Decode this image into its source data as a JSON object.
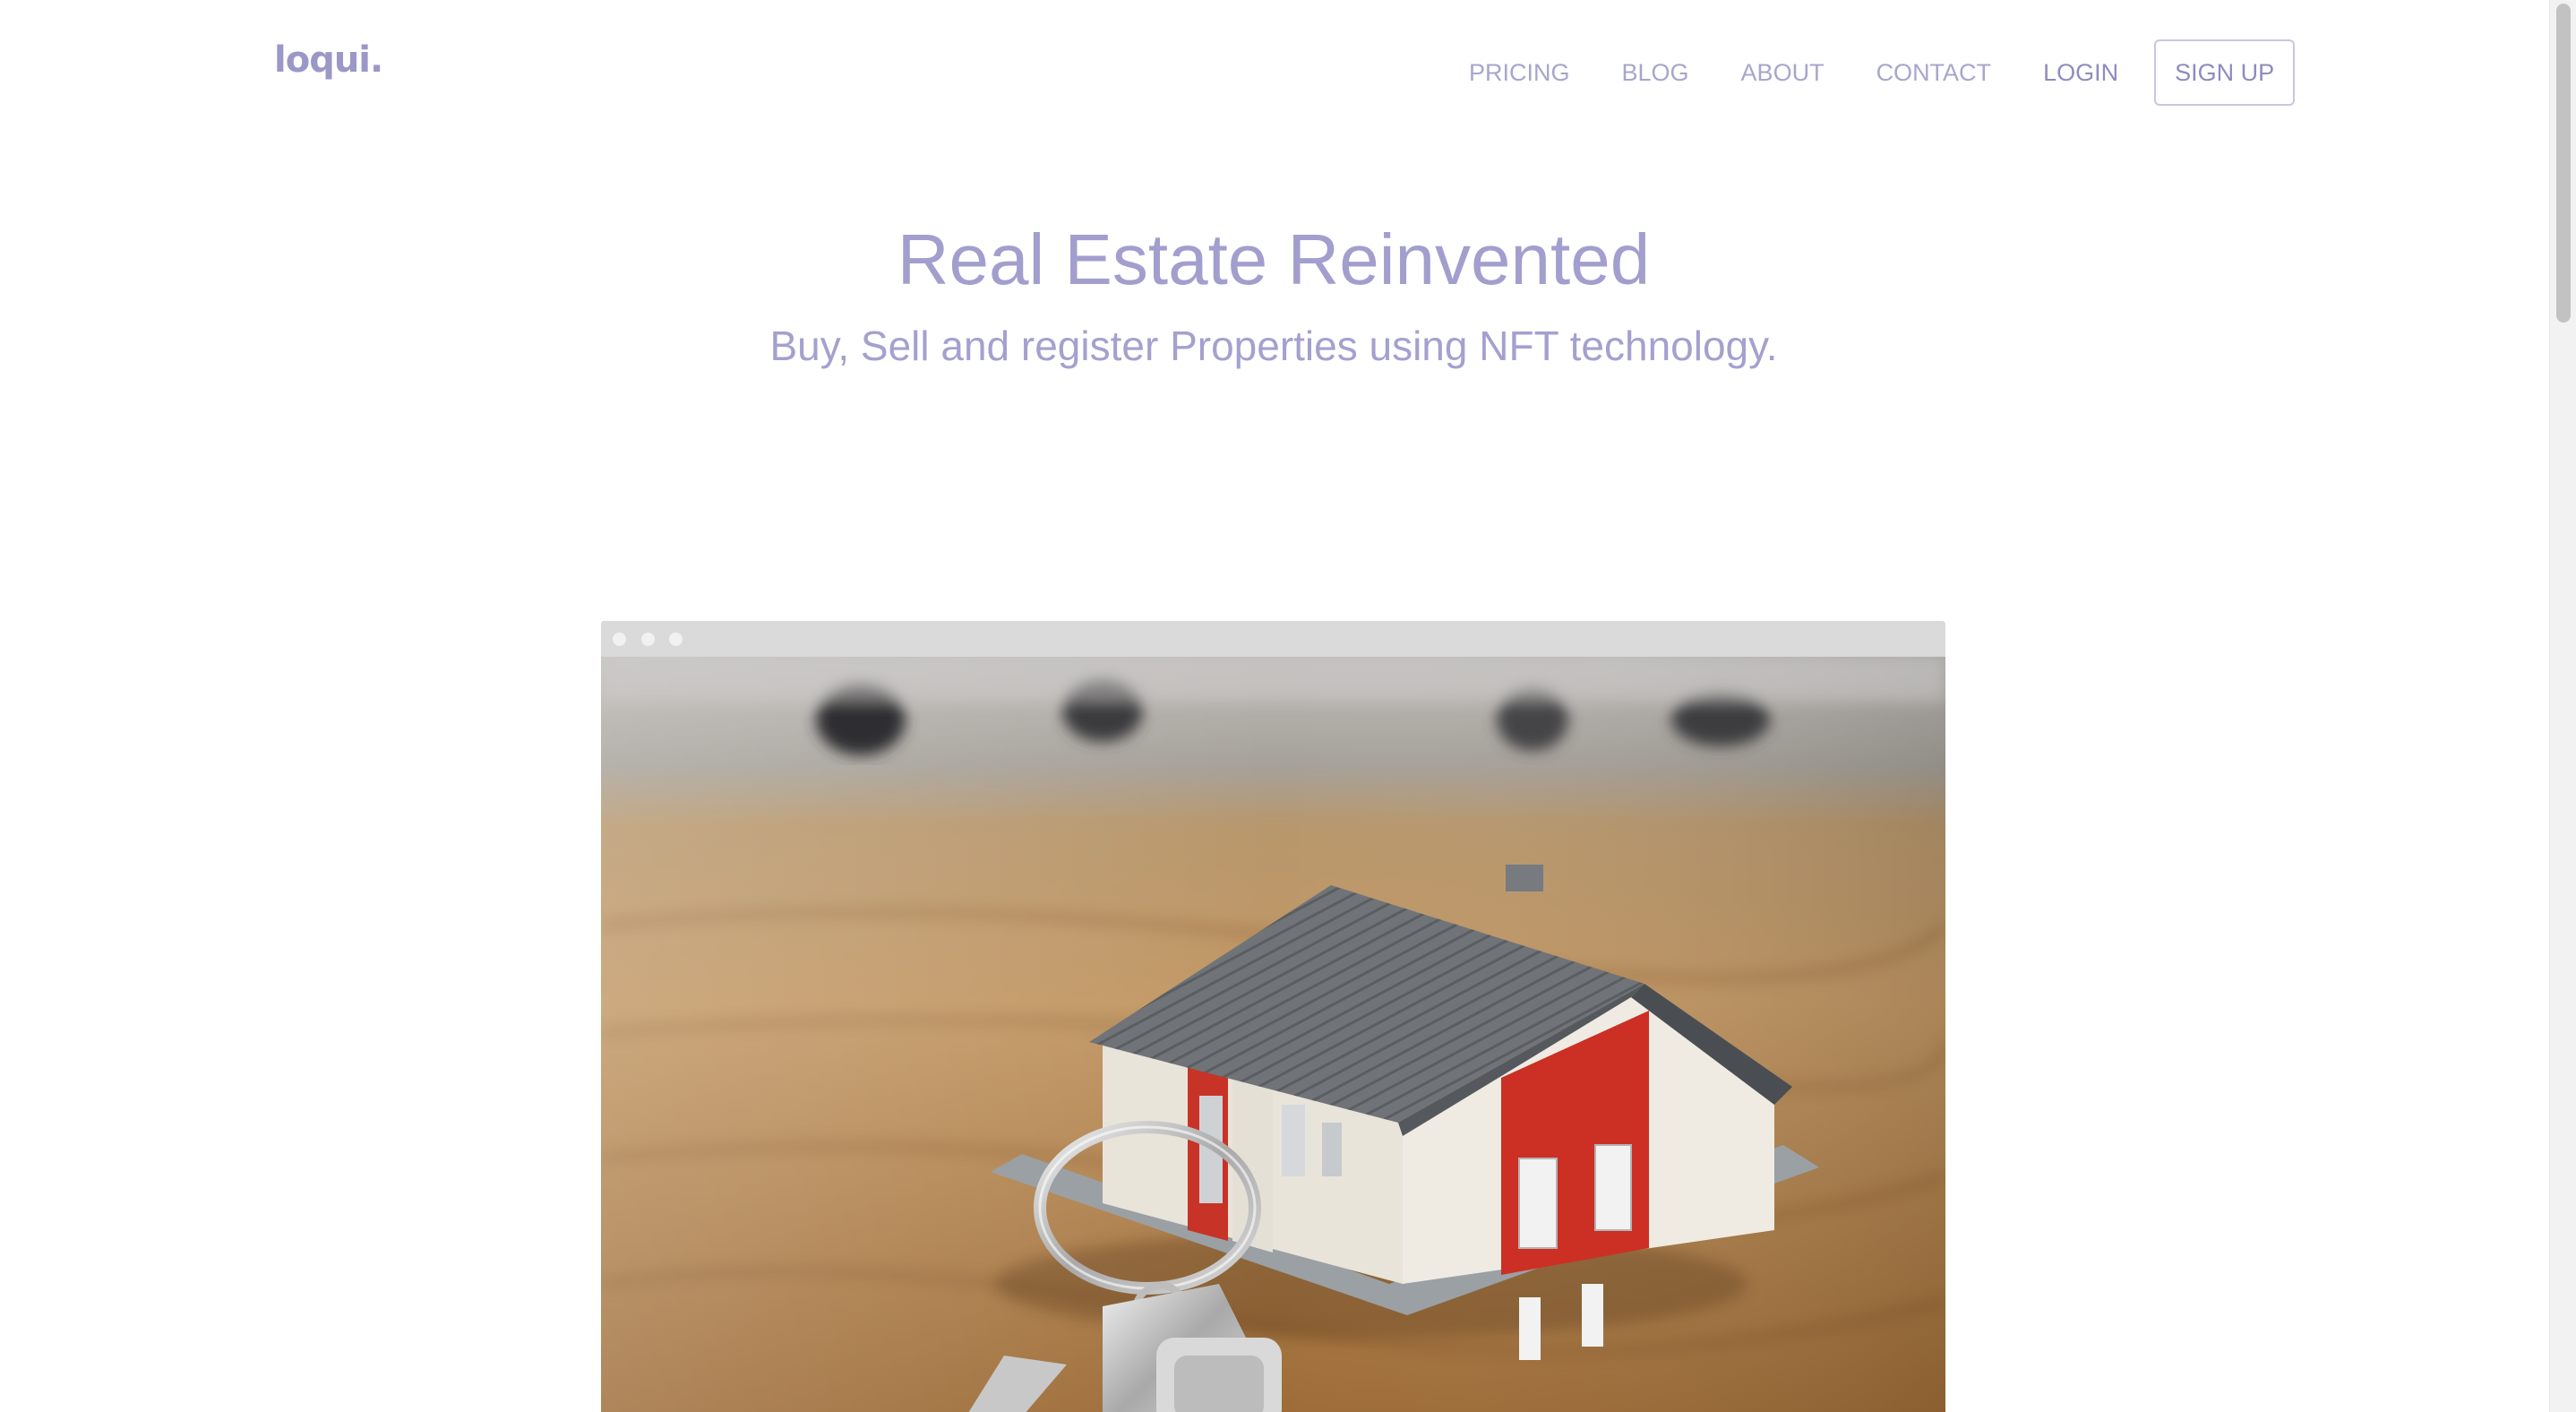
{
  "brand": {
    "logo_text": "loqui."
  },
  "nav": {
    "links": [
      "PRICING",
      "BLOG",
      "ABOUT",
      "CONTACT"
    ],
    "login_label": "LOGIN",
    "signup_label": "SIGN UP"
  },
  "hero": {
    "title": "Real Estate Reinvented",
    "subtitle": "Buy, Sell and register Properties using NFT technology."
  },
  "mockup": {
    "image_subject": "model-house-with-keys"
  },
  "colors": {
    "accent": "#9b97c6",
    "text_light": "#a8a5cc",
    "background": "#ffffff",
    "mockup_bar": "#dadada"
  }
}
